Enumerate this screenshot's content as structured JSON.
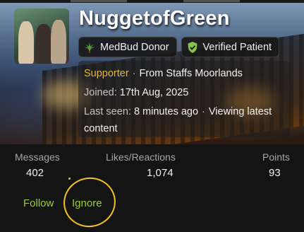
{
  "profile": {
    "username": "NuggetofGreen",
    "badges": [
      {
        "label": "MedBud Donor",
        "icon": "cannabis-leaf-icon",
        "color": "#5a9e2f"
      },
      {
        "label": "Verified Patient",
        "icon": "verified-check-icon",
        "color": "#8bc34a"
      }
    ],
    "title": "Supporter",
    "location": "From Staffs Moorlands",
    "joined_label": "Joined:",
    "joined_value": "17th Aug, 2025",
    "last_seen_label": "Last seen:",
    "last_seen_value": "8 minutes ago",
    "activity_line1": "Viewing latest",
    "activity_line2": "content"
  },
  "stats": [
    {
      "label": "Messages",
      "value": "402"
    },
    {
      "label": "Likes/Reactions",
      "value": "1,074"
    },
    {
      "label": "Points",
      "value": "93"
    }
  ],
  "actions": {
    "follow": "Follow",
    "ignore": "Ignore"
  },
  "colors": {
    "accent_green": "#9acd32",
    "supporter_gold": "#e3b73a",
    "annotation_circle": "#f1c21b"
  }
}
